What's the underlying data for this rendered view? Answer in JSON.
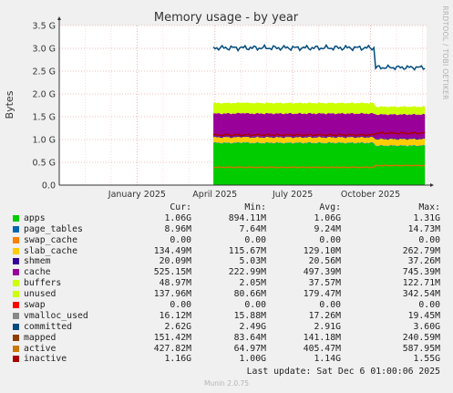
{
  "chart_data": {
    "type": "area",
    "title": "Memory usage - by year",
    "ylabel": "Bytes",
    "side_label": "RRDTOOL / TOBI OETIKER",
    "y_ticks": [
      "0.0",
      "0.5 G",
      "1.0 G",
      "1.5 G",
      "2.0 G",
      "2.5 G",
      "3.0 G",
      "3.5 G"
    ],
    "y_tick_values": [
      0,
      0.5,
      1.0,
      1.5,
      2.0,
      2.5,
      3.0,
      3.5
    ],
    "ylim": [
      0,
      3.5
    ],
    "x_ticks": [
      "January 2025",
      "April 2025",
      "July 2025",
      "October 2025"
    ],
    "x_tick_values": [
      2025.0,
      2025.25,
      2025.5,
      2025.75
    ],
    "xlim": [
      2024.75,
      2025.93
    ],
    "data_start": 2025.245,
    "step_at": 2025.765,
    "stack": [
      {
        "name": "apps",
        "color": "#00cc00",
        "before": 0.92,
        "after": 0.86,
        "dip_at": 2025.33,
        "dip": 0.93
      },
      {
        "name": "page_tables",
        "color": "#0066b3",
        "before": 0.009,
        "after": 0.009
      },
      {
        "name": "swap_cache",
        "color": "#ff8000",
        "before": 0.0,
        "after": 0.0
      },
      {
        "name": "slab_cache",
        "color": "#ffcc00",
        "before": 0.12,
        "after": 0.14
      },
      {
        "name": "shmem",
        "color": "#330099",
        "before": 0.021,
        "after": 0.021
      },
      {
        "name": "cache",
        "color": "#990099",
        "before": 0.5,
        "after": 0.52
      },
      {
        "name": "buffers",
        "color": "#ccff00",
        "before": 0.04,
        "after": 0.05
      },
      {
        "name": "unused",
        "color": "#ccff00",
        "before": 0.19,
        "after": 0.12
      }
    ],
    "lines": [
      {
        "name": "committed",
        "color": "#004c7f",
        "before": 3.01,
        "after": 2.58
      },
      {
        "name": "active",
        "color": "#cc7700",
        "before": 0.39,
        "after": 0.43
      },
      {
        "name": "inactive",
        "color": "#aa0000",
        "before": 1.1,
        "after": 1.14
      }
    ]
  },
  "legend": {
    "headers": {
      "cur": "Cur:",
      "min": "Min:",
      "avg": "Avg:",
      "max": "Max:"
    },
    "rows": [
      {
        "name": "apps",
        "color": "#00cc00",
        "cur": "1.06G",
        "min": "894.11M",
        "avg": "1.06G",
        "max": "1.31G"
      },
      {
        "name": "page_tables",
        "color": "#0066b3",
        "cur": "8.96M",
        "min": "7.64M",
        "avg": "9.24M",
        "max": "14.73M"
      },
      {
        "name": "swap_cache",
        "color": "#ff8000",
        "cur": "0.00",
        "min": "0.00",
        "avg": "0.00",
        "max": "0.00"
      },
      {
        "name": "slab_cache",
        "color": "#ffcc00",
        "cur": "134.49M",
        "min": "115.67M",
        "avg": "129.10M",
        "max": "262.79M"
      },
      {
        "name": "shmem",
        "color": "#330099",
        "cur": "20.09M",
        "min": "5.03M",
        "avg": "20.56M",
        "max": "37.26M"
      },
      {
        "name": "cache",
        "color": "#990099",
        "cur": "525.15M",
        "min": "222.99M",
        "avg": "497.39M",
        "max": "745.39M"
      },
      {
        "name": "buffers",
        "color": "#ccff00",
        "cur": "48.97M",
        "min": "2.05M",
        "avg": "37.57M",
        "max": "122.71M"
      },
      {
        "name": "unused",
        "color": "#ccff00",
        "cur": "137.96M",
        "min": "80.66M",
        "avg": "179.47M",
        "max": "342.54M"
      },
      {
        "name": "swap",
        "color": "#ff0000",
        "cur": "0.00",
        "min": "0.00",
        "avg": "0.00",
        "max": "0.00"
      },
      {
        "name": "vmalloc_used",
        "color": "#888888",
        "cur": "16.12M",
        "min": "15.88M",
        "avg": "17.26M",
        "max": "19.45M"
      },
      {
        "name": "committed",
        "color": "#004c7f",
        "cur": "2.62G",
        "min": "2.49G",
        "avg": "2.91G",
        "max": "3.60G"
      },
      {
        "name": "mapped",
        "color": "#8f3d00",
        "cur": "151.42M",
        "min": "83.64M",
        "avg": "141.18M",
        "max": "240.59M"
      },
      {
        "name": "active",
        "color": "#cc7700",
        "cur": "427.82M",
        "min": "64.97M",
        "avg": "405.47M",
        "max": "587.95M"
      },
      {
        "name": "inactive",
        "color": "#aa0000",
        "cur": "1.16G",
        "min": "1.00G",
        "avg": "1.14G",
        "max": "1.55G"
      }
    ]
  },
  "footer": {
    "last_update": "Last update: Sat Dec  6 01:00:06 2025",
    "munin": "Munin 2.0.75"
  }
}
